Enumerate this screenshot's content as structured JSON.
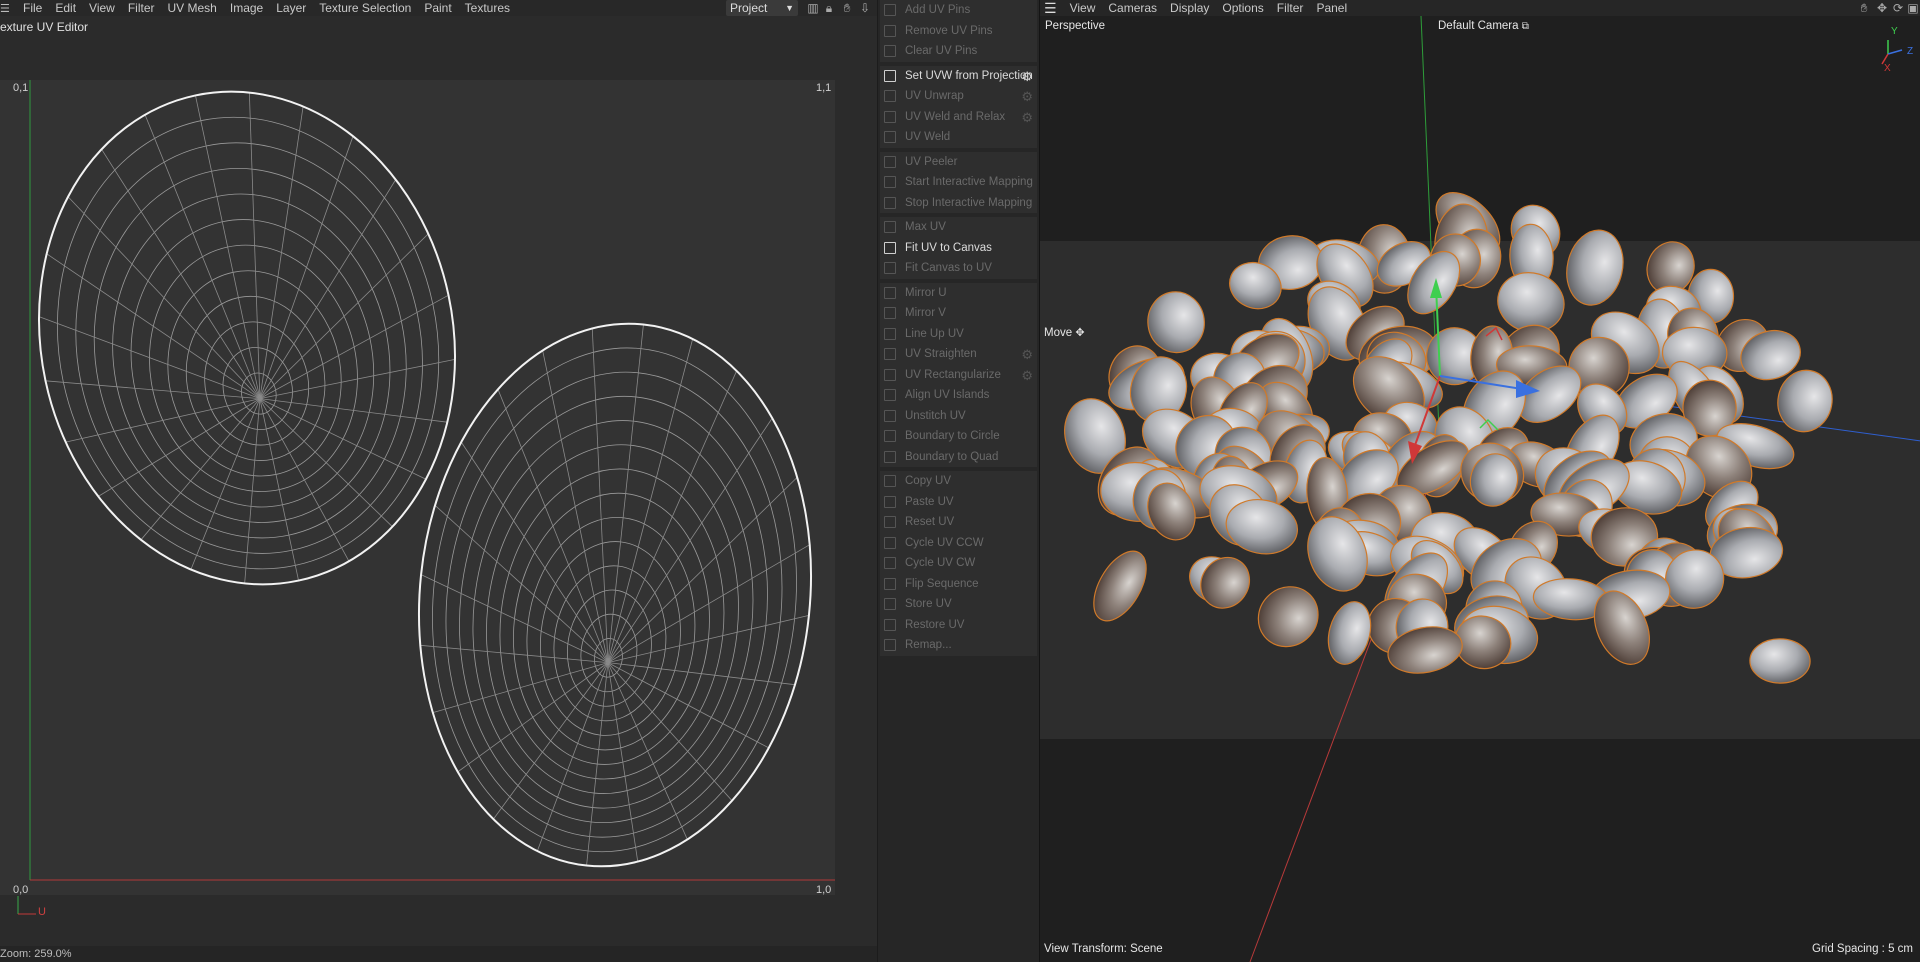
{
  "uv_editor": {
    "menu": [
      "File",
      "Edit",
      "View",
      "Filter",
      "UV Mesh",
      "Image",
      "Layer",
      "Texture Selection",
      "Paint",
      "Textures"
    ],
    "project_select": "Project",
    "title": "exture UV Editor",
    "corner_labels": {
      "top_left": "0,1",
      "top_right": "1,1",
      "bottom_left": "0,0",
      "bottom_right": "1,0"
    },
    "axis_u": "U",
    "zoom": "Zoom: 259.0%"
  },
  "commands": {
    "groups": [
      [
        {
          "label": "Add UV Pins",
          "enabled": false,
          "gear": false
        },
        {
          "label": "Remove UV Pins",
          "enabled": false,
          "gear": false
        },
        {
          "label": "Clear UV Pins",
          "enabled": false,
          "gear": false
        }
      ],
      [
        {
          "label": "Set UVW from Projection",
          "enabled": true,
          "gear": true
        },
        {
          "label": "UV Unwrap",
          "enabled": false,
          "gear": true
        },
        {
          "label": "UV Weld and Relax",
          "enabled": false,
          "gear": true
        },
        {
          "label": "UV Weld",
          "enabled": false,
          "gear": false
        }
      ],
      [
        {
          "label": "UV Peeler",
          "enabled": false,
          "gear": false
        },
        {
          "label": "Start Interactive Mapping",
          "enabled": false,
          "gear": false
        },
        {
          "label": "Stop Interactive Mapping",
          "enabled": false,
          "gear": false
        }
      ],
      [
        {
          "label": "Max UV",
          "enabled": false,
          "gear": false
        },
        {
          "label": "Fit UV to Canvas",
          "enabled": true,
          "gear": false
        },
        {
          "label": "Fit Canvas to UV",
          "enabled": false,
          "gear": false
        }
      ],
      [
        {
          "label": "Mirror U",
          "enabled": false,
          "gear": false
        },
        {
          "label": "Mirror V",
          "enabled": false,
          "gear": false
        },
        {
          "label": "Line Up UV",
          "enabled": false,
          "gear": false
        },
        {
          "label": "UV Straighten",
          "enabled": false,
          "gear": true
        },
        {
          "label": "UV Rectangularize",
          "enabled": false,
          "gear": true
        },
        {
          "label": "Align UV Islands",
          "enabled": false,
          "gear": false
        },
        {
          "label": "Unstitch UV",
          "enabled": false,
          "gear": false
        },
        {
          "label": "Boundary to Circle",
          "enabled": false,
          "gear": false
        },
        {
          "label": "Boundary to Quad",
          "enabled": false,
          "gear": false
        }
      ],
      [
        {
          "label": "Copy UV",
          "enabled": false,
          "gear": false
        },
        {
          "label": "Paste UV",
          "enabled": false,
          "gear": false
        },
        {
          "label": "Reset UV",
          "enabled": false,
          "gear": false
        },
        {
          "label": "Cycle UV CCW",
          "enabled": false,
          "gear": false
        },
        {
          "label": "Cycle UV CW",
          "enabled": false,
          "gear": false
        },
        {
          "label": "Flip Sequence",
          "enabled": false,
          "gear": false
        },
        {
          "label": "Store UV",
          "enabled": false,
          "gear": false
        },
        {
          "label": "Restore UV",
          "enabled": false,
          "gear": false
        },
        {
          "label": "Remap...",
          "enabled": false,
          "gear": false
        }
      ]
    ]
  },
  "viewport": {
    "menu": [
      "View",
      "Cameras",
      "Display",
      "Options",
      "Filter",
      "Panel"
    ],
    "view_name": "Perspective",
    "camera": "Default Camera",
    "tool": "Move",
    "view_transform": "View Transform: Scene",
    "grid_spacing": "Grid Spacing : 5 cm",
    "axis_labels": {
      "y": "Y",
      "z": "Z",
      "x": "X"
    }
  },
  "colors": {
    "accent_orange": "#d07a2a",
    "axis_green": "#4fbf4f",
    "axis_red": "#cf3a3a",
    "axis_blue": "#3a6fdc"
  }
}
